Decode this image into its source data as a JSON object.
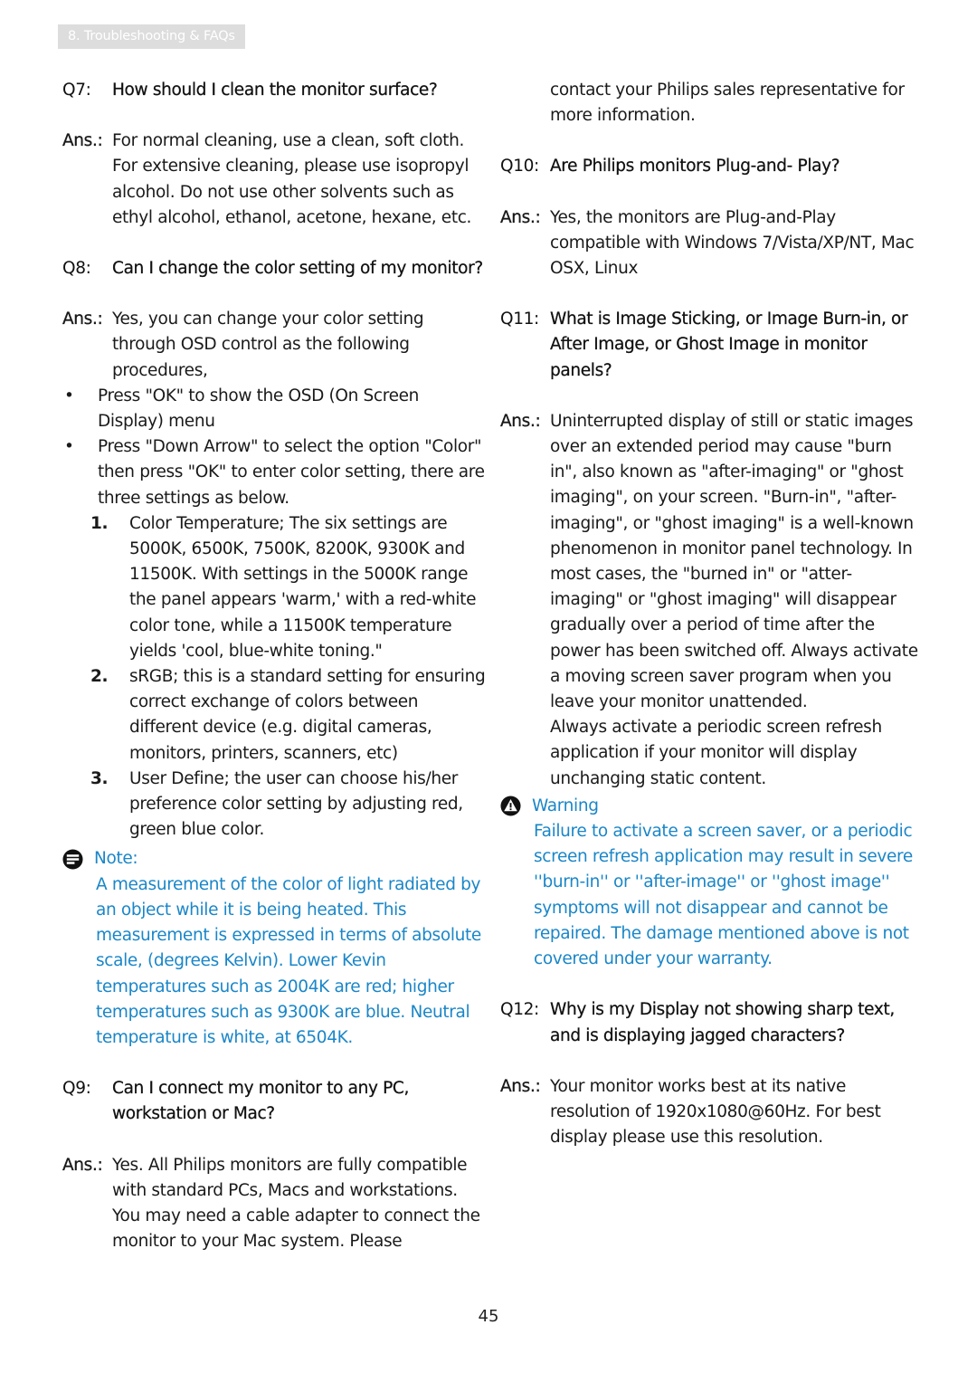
{
  "header": {
    "section_tab": "8. Troubleshooting & FAQs"
  },
  "left_column": {
    "q7": {
      "label": "Q7:",
      "question": "How should I clean the monitor surface?",
      "ans_label": "Ans.:",
      "answer": "For normal cleaning, use a clean, soft cloth. For extensive cleaning, please use isopropyl alcohol. Do not use other solvents such as ethyl alcohol, ethanol, acetone, hexane, etc."
    },
    "q8": {
      "label": "Q8:",
      "question": "Can I change the color setting of my monitor?",
      "ans_label": "Ans.:",
      "answer": "Yes, you can change your color setting through OSD control as the following procedures,",
      "bullets": [
        "Press \"OK\" to show the OSD (On Screen Display) menu",
        "Press \"Down Arrow\" to select the option \"Color\" then press \"OK\" to enter color setting, there are three settings as below."
      ],
      "numbered": [
        {
          "num": "1.",
          "text": "Color Temperature; The six settings are 5000K, 6500K, 7500K, 8200K, 9300K and 11500K. With settings in the 5000K range the panel appears 'warm,' with a red-white color tone, while a 11500K temperature yields 'cool, blue-white toning.\""
        },
        {
          "num": "2.",
          "text": "sRGB; this is a standard setting for ensuring correct exchange of colors between different device (e.g. digital cameras, monitors, printers, scanners, etc)"
        },
        {
          "num": "3.",
          "text": "User Define; the user can choose his/her preference color setting by adjusting red, green blue color."
        }
      ],
      "note": {
        "icon": "note-icon",
        "title": "Note:",
        "body": "A measurement of the color of light radiated by an object while it is being heated. This measurement is expressed in terms of absolute scale, (degrees Kelvin). Lower Kevin temperatures such as 2004K are red; higher temperatures such as 9300K are blue. Neutral temperature is white, at 6504K."
      }
    },
    "q9": {
      "label": "Q9:",
      "question": "Can I connect my monitor to any PC, workstation or Mac?",
      "ans_label": "Ans.:",
      "answer": "Yes. All Philips monitors are fully compatible with standard PCs, Macs and workstations. You may need a cable adapter to connect the monitor to your Mac system. Please"
    }
  },
  "right_column": {
    "q9_continued": "contact your Philips sales representative for more information.",
    "q10": {
      "label": "Q10:",
      "question": "Are Philips monitors Plug-and- Play?",
      "ans_label": "Ans.:",
      "answer": "Yes, the monitors are Plug-and-Play compatible with Windows 7/Vista/XP/NT, Mac OSX, Linux"
    },
    "q11": {
      "label": "Q11:",
      "question": "What is Image Sticking, or Image Burn-in, or After Image, or Ghost Image in monitor panels?",
      "ans_label": "Ans.:",
      "answer": "Uninterrupted display of still or static images over an extended period may cause \"burn in\", also known as \"after-imaging\" or \"ghost imaging\", on your screen. \"Burn-in\", \"after-imaging\", or \"ghost imaging\" is a well-known phenomenon in monitor panel technology. In most cases, the \"burned in\" or \"atter-imaging\" or \"ghost imaging\" will disappear gradually over a period of time after the power has been switched off. Always activate a moving screen saver program when you leave your monitor unattended.",
      "answer_2": "Always activate a periodic screen refresh application if your monitor will display unchanging static content.",
      "warning": {
        "icon": "warning-icon",
        "title": "Warning",
        "body": "Failure to activate a screen saver, or a periodic screen refresh application may result in severe ''burn-in'' or ''after-image'' or ''ghost image'' symptoms will not disappear and cannot be repaired. The damage mentioned above is not covered under your warranty."
      }
    },
    "q12": {
      "label": "Q12:",
      "question": "Why is my Display not showing sharp text, and is displaying jagged characters?",
      "ans_label": "Ans.:",
      "answer": "Your monitor works best at its native resolution of 1920x1080@60Hz. For best display please use this resolution."
    }
  },
  "footer": {
    "page_number": "45"
  },
  "colors": {
    "accent": "#1a86c8",
    "tab_bg": "#dcdddc",
    "text": "#1a1a1a"
  }
}
